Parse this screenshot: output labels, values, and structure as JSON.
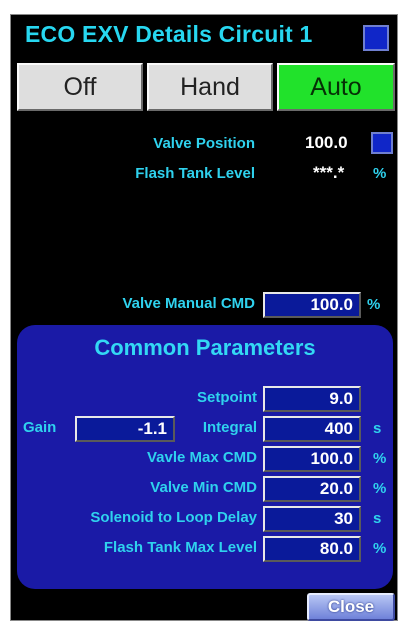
{
  "header": {
    "title": "ECO EXV Details Circuit 1"
  },
  "modes": {
    "off": "Off",
    "hand": "Hand",
    "auto": "Auto",
    "active": "auto"
  },
  "status": {
    "valve_position_label": "Valve Position",
    "valve_position_value": "100.0",
    "flash_tank_level_label": "Flash Tank Level",
    "flash_tank_level_value": "***.*",
    "flash_tank_level_unit": "%"
  },
  "manual": {
    "label": "Valve Manual CMD",
    "value": "100.0",
    "unit": "%"
  },
  "common": {
    "title": "Common Parameters",
    "setpoint": {
      "label": "Setpoint",
      "value": "9.0"
    },
    "gain": {
      "label": "Gain",
      "value": "-1.1"
    },
    "integral": {
      "label": "Integral",
      "value": "400",
      "unit": "s"
    },
    "max_cmd": {
      "label": "Vavle Max CMD",
      "value": "100.0",
      "unit": "%"
    },
    "min_cmd": {
      "label": "Valve Min CMD",
      "value": "20.0",
      "unit": "%"
    },
    "solenoid_delay": {
      "label": "Solenoid to Loop Delay",
      "value": "30",
      "unit": "s"
    },
    "flash_tank_max": {
      "label": "Flash Tank Max Level",
      "value": "80.0",
      "unit": "%"
    }
  },
  "footer": {
    "close_label": "Close"
  },
  "colors": {
    "accent": "#27d7f0",
    "panel_blue": "#1a1aa6",
    "auto_green": "#21e22b"
  }
}
